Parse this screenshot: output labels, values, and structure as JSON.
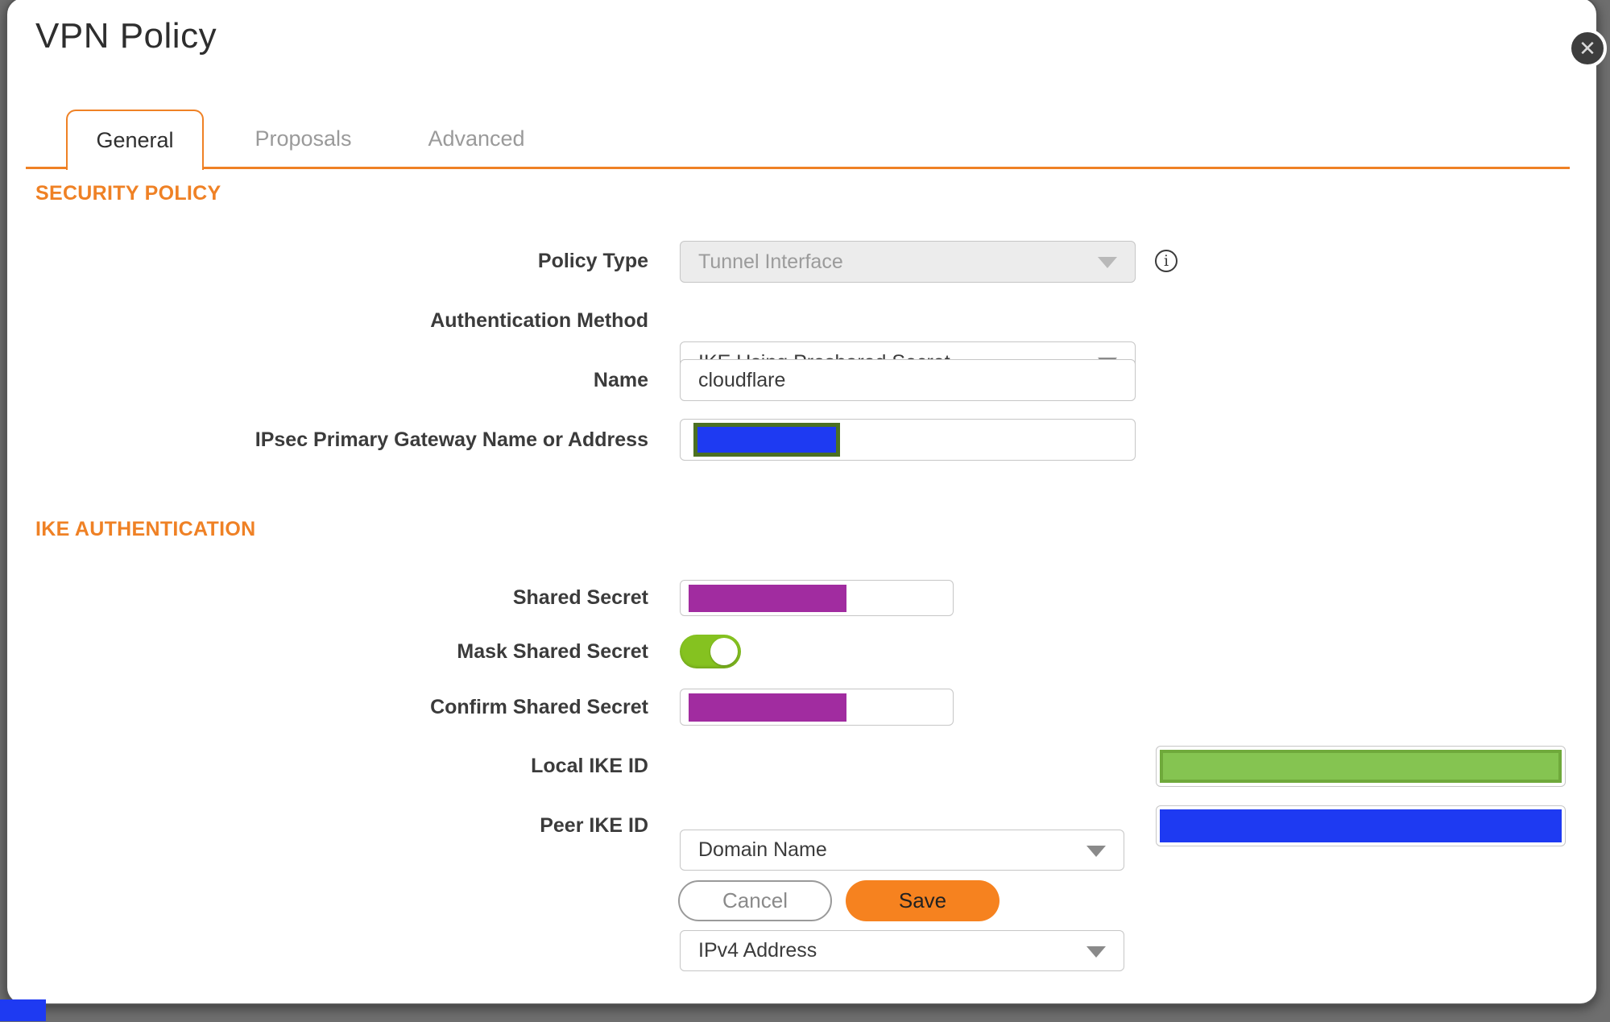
{
  "dialog": {
    "title": "VPN Policy",
    "close_icon": "✕"
  },
  "tabs": [
    {
      "label": "General",
      "active": true
    },
    {
      "label": "Proposals",
      "active": false
    },
    {
      "label": "Advanced",
      "active": false
    }
  ],
  "sections": {
    "security_policy": {
      "heading": "SECURITY POLICY"
    },
    "ike_authentication": {
      "heading": "IKE AUTHENTICATION"
    }
  },
  "fields": {
    "policy_type": {
      "label": "Policy Type",
      "value": "Tunnel Interface",
      "disabled": true,
      "info_icon": "i"
    },
    "authentication_method": {
      "label": "Authentication Method",
      "value": "IKE Using Preshared Secret"
    },
    "name": {
      "label": "Name",
      "value": "cloudflare",
      "placeholder": ""
    },
    "ipsec_primary_gateway": {
      "label": "IPsec Primary Gateway Name or Address",
      "value": "",
      "redacted": true
    },
    "shared_secret": {
      "label": "Shared Secret",
      "value": "",
      "redacted": true
    },
    "mask_shared_secret": {
      "label": "Mask Shared Secret",
      "state": "on"
    },
    "confirm_shared_secret": {
      "label": "Confirm Shared Secret",
      "value": "",
      "redacted": true
    },
    "local_ike_id": {
      "label": "Local IKE ID",
      "value": "Domain Name",
      "id_value_redacted": true
    },
    "peer_ike_id": {
      "label": "Peer IKE ID",
      "value": "IPv4 Address",
      "id_value_redacted": true
    }
  },
  "buttons": {
    "cancel": "Cancel",
    "save": "Save"
  },
  "colors": {
    "accent_orange": "#ef8125",
    "save_orange": "#f6821f",
    "toggle_green": "#85c220",
    "redaction_purple": "#a12ca0",
    "redaction_blue": "#1e3af2",
    "redaction_green_fill": "#85c451",
    "redaction_green_border": "#6fa93b",
    "gateway_redaction_border": "#4c7022",
    "page_background": "#6e6e6e"
  }
}
